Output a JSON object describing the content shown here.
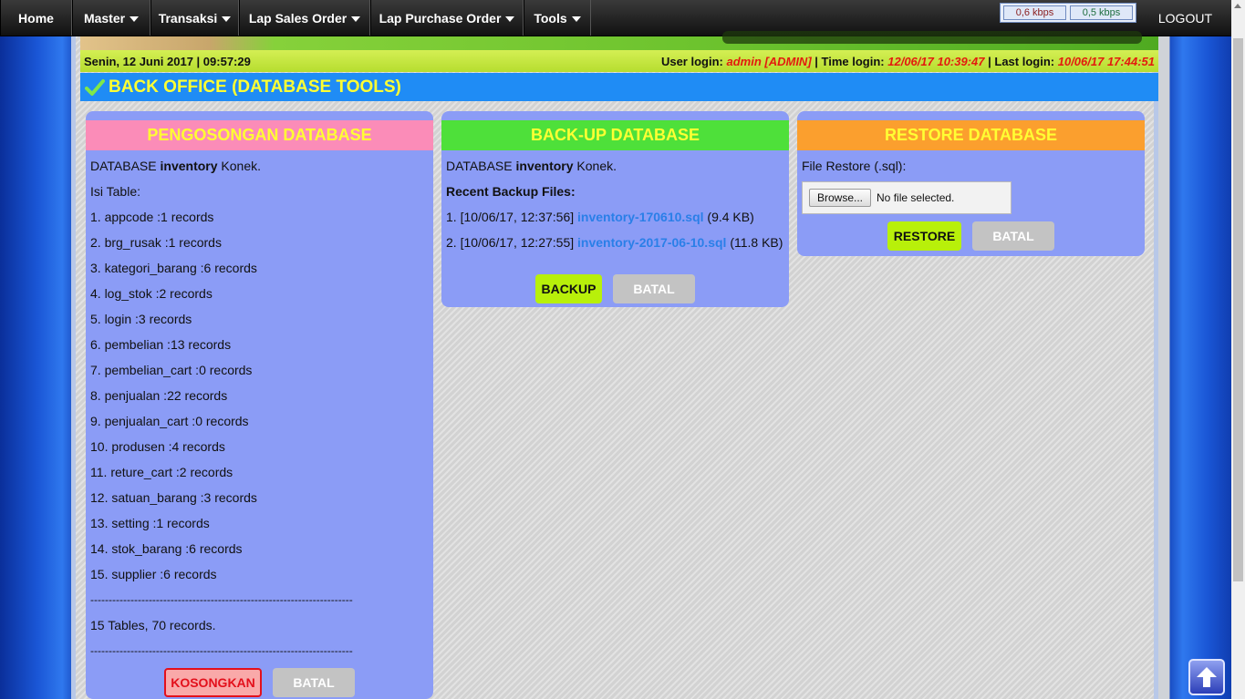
{
  "nav": {
    "items": [
      {
        "label": "Home",
        "dropdown": false
      },
      {
        "label": "Master",
        "dropdown": true
      },
      {
        "label": "Transaksi",
        "dropdown": true
      },
      {
        "label": "Lap Sales Order",
        "dropdown": true
      },
      {
        "label": "Lap Purchase Order",
        "dropdown": true
      },
      {
        "label": "Tools",
        "dropdown": true
      }
    ],
    "kbps_down": "0,6 kbps",
    "kbps_up": "0,5 kbps",
    "logout": "LOGOUT"
  },
  "infobar": {
    "date": "Senin, 12 Juni 2017 | 09:57:29",
    "user_login_label": "User login:",
    "user_login_value": "admin [ADMIN]",
    "time_login_label": "| Time login:",
    "time_login_value": "12/06/17 10:39:47",
    "last_login_label": "| Last login:",
    "last_login_value": "10/06/17 17:44:51"
  },
  "page_title": "BACK OFFICE (DATABASE TOOLS)",
  "panel_empty": {
    "title": "PENGOSONGAN DATABASE",
    "db_prefix": "DATABASE",
    "db_name": "inventory",
    "db_status": "Konek.",
    "isi_table": "Isi Table:",
    "tables": [
      "1. appcode :1 records",
      "2. brg_rusak :1 records",
      "3. kategori_barang :6 records",
      "4. log_stok :2 records",
      "5. login :3 records",
      "6. pembelian :13 records",
      "7. pembelian_cart :0 records",
      "8. penjualan :22 records",
      "9. penjualan_cart :0 records",
      "10. produsen :4 records",
      "11. reture_cart :2 records",
      "12. satuan_barang :3 records",
      "13. setting :1 records",
      "14. stok_barang :6 records",
      "15. supplier :6 records"
    ],
    "separator": "------------------------------------------------------------------------",
    "summary": "15 Tables, 70 records.",
    "btn_empty": "KOSONGKAN",
    "btn_cancel": "BATAL"
  },
  "panel_backup": {
    "title": "BACK-UP DATABASE",
    "db_prefix": "DATABASE",
    "db_name": "inventory",
    "db_status": "Konek.",
    "recent_label": "Recent Backup Files:",
    "files": [
      {
        "prefix": "1. [10/06/17, 12:37:56]",
        "name": "inventory-170610.sql",
        "size": "(9.4 KB)"
      },
      {
        "prefix": "2. [10/06/17, 12:27:55]",
        "name": "inventory-2017-06-10.sql",
        "size": "(11.8 KB)"
      }
    ],
    "btn_backup": "BACKUP",
    "btn_cancel": "BATAL"
  },
  "panel_restore": {
    "title": "RESTORE DATABASE",
    "file_label": "File Restore (.sql):",
    "browse_label": "Browse...",
    "no_file": "No file selected.",
    "btn_restore": "RESTORE",
    "btn_cancel": "BATAL"
  },
  "colors": {
    "panel_bg": "#8b9cf6",
    "empty_head": "#fb8cb8",
    "backup_head": "#4ee03a",
    "restore_head": "#fb9f2e",
    "title_bar": "#1f8cf5",
    "accent_yellow": "#ffff33"
  }
}
